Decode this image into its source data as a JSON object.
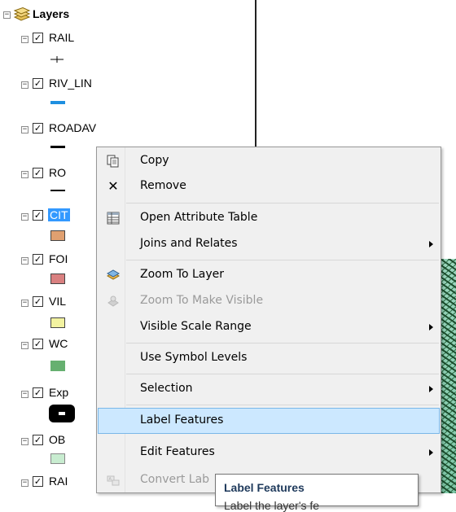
{
  "toc": {
    "root_label": "Layers",
    "layers": [
      {
        "label": "RAIL",
        "checked": true
      },
      {
        "label": "RIV_LIN",
        "checked": true
      },
      {
        "label": "ROADAV",
        "checked": true
      },
      {
        "label": "RO",
        "checked": true
      },
      {
        "label": "CIT",
        "checked": true,
        "selected": true
      },
      {
        "label": "FOI",
        "checked": true
      },
      {
        "label": "VIL",
        "checked": true
      },
      {
        "label": "WC",
        "checked": true
      },
      {
        "label": "Exp",
        "checked": true
      },
      {
        "label": "OB",
        "checked": true
      },
      {
        "label": "RAI",
        "checked": true
      }
    ],
    "colors": {
      "selection": "#3399ff",
      "cit_fill": "#e0a070",
      "foi_fill": "#d98080",
      "vil_fill": "#f2f2a0",
      "wc_fill": "#66b070",
      "ob_fill": "#c8ecd0",
      "riv_line": "#1e8fe0"
    }
  },
  "menu": {
    "items": [
      {
        "label": "Copy",
        "icon": "copy-icon"
      },
      {
        "label": "Remove",
        "icon": "remove-icon"
      },
      {
        "label": "Open Attribute Table",
        "icon": "table-icon"
      },
      {
        "label": "Joins and Relates",
        "submenu": true
      },
      {
        "label": "Zoom To Layer",
        "icon": "zoom-layer-icon"
      },
      {
        "label": "Zoom To Make Visible",
        "icon": "zoom-visible-icon",
        "disabled": true
      },
      {
        "label": "Visible Scale Range",
        "submenu": true
      },
      {
        "label": "Use Symbol Levels"
      },
      {
        "label": "Selection",
        "submenu": true
      },
      {
        "label": "Label Features",
        "highlighted": true
      },
      {
        "label": "Edit Features",
        "submenu": true
      },
      {
        "label": "Convert Lab",
        "icon": "convert-labels-icon",
        "disabled": true
      }
    ],
    "highlight_color": "#cce8ff"
  },
  "tooltip": {
    "title": "Label Features",
    "body": "Label the layer's fe"
  }
}
